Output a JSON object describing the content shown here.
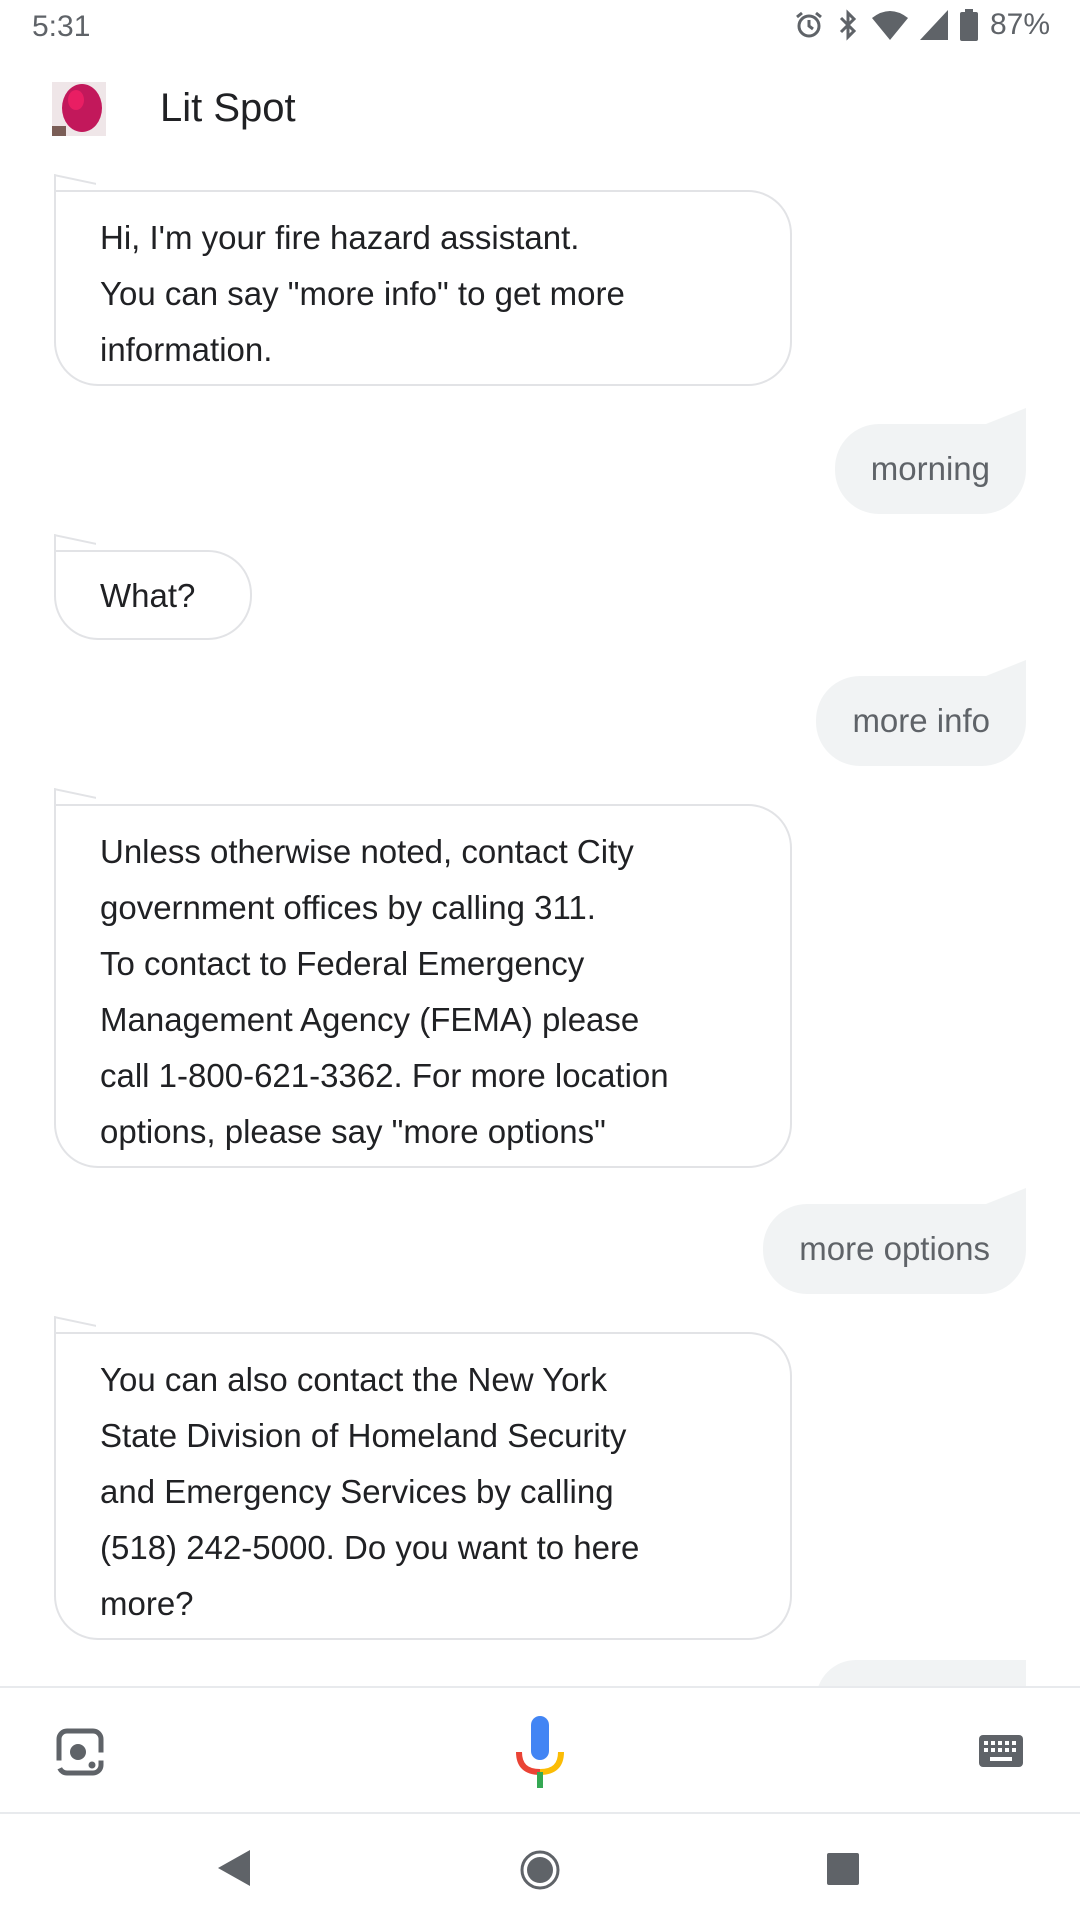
{
  "status_bar": {
    "time": "5:31",
    "battery": "87%",
    "icons": [
      "alarm-icon",
      "bluetooth-icon",
      "wifi-icon",
      "signal-icon",
      "battery-icon"
    ]
  },
  "app": {
    "title": "Lit Spot"
  },
  "messages": [
    {
      "role": "bot",
      "lines": [
        "Hi, I'm your fire hazard assistant.",
        "You can say \"more info\" to get more",
        "information."
      ]
    },
    {
      "role": "user",
      "text": "morning"
    },
    {
      "role": "bot",
      "lines": [
        "What?"
      ]
    },
    {
      "role": "user",
      "text": "more info"
    },
    {
      "role": "bot",
      "lines": [
        "Unless otherwise noted, contact City",
        "government offices by calling 311.",
        "To contact to Federal Emergency",
        "Management Agency (FEMA) please",
        "call 1-800-621-3362. For more location",
        "options, please say \"more options\""
      ]
    },
    {
      "role": "user",
      "text": "more options"
    },
    {
      "role": "bot",
      "lines": [
        "You can also contact the New York",
        "State Division of Homeland Security",
        "and Emergency Services by calling",
        "(518) 242-5000. Do you want to here",
        "more?"
      ]
    }
  ],
  "colors": {
    "bot_border": "#e2e3e6",
    "user_bubble": "#f1f3f4",
    "mic_blue": "#4285f4",
    "mic_red": "#ea4335",
    "mic_yellow": "#fbbc05",
    "mic_green": "#34a853"
  }
}
